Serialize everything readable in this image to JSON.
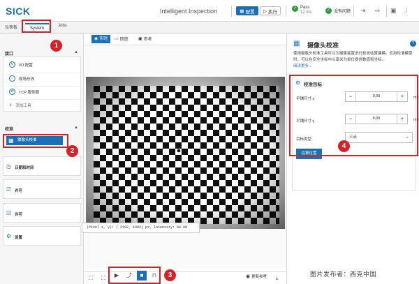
{
  "app": {
    "logo": "SICK",
    "title": "Intelligent Inspection",
    "config_label": "配置",
    "run_label": "执行",
    "pass_status": "Pass",
    "pass_time": "12 ms",
    "ok_status": "没有问题"
  },
  "tabs": [
    {
      "label": "仪表板"
    },
    {
      "label": "System"
    },
    {
      "label": "Jobs"
    }
  ],
  "sidebar": {
    "interface_title": "接口",
    "interface_items": [
      {
        "label": "I/O 配置",
        "icon": "io-icon"
      },
      {
        "label": "现场总线",
        "icon": "fieldbus-icon"
      },
      {
        "label": "TCP 服务器",
        "icon": "tcp-server-icon"
      }
    ],
    "add_tool": "添加工具",
    "calib_title": "校准",
    "calib_item": "摄像头校准",
    "nav_items": [
      {
        "label": "日期和时间"
      },
      {
        "label": "许可"
      },
      {
        "label": "许可"
      },
      {
        "label": "设置"
      }
    ]
  },
  "viewer": {
    "tab_live": "实时",
    "tab_playback": "回放",
    "tab_reference": "参考",
    "pixel_readout": "(Pixel x, y): ( 2192,  1982) px, Intensity:     94.00",
    "more_ref": "更新参考"
  },
  "panel": {
    "title": "摄像头校准",
    "description": "使用摄像头校准工具可以为摄像装置进行校准估算建模。应用校准模型时，可以在安全坐标中以毫米为单位提供数值和坐标。",
    "read_more": "阅读更多...",
    "calib_target_title": "校准目标",
    "tile_x_label": "平铺尺寸 x",
    "tile_x_value": "9.00",
    "tile_y_label": "平铺尺寸 y",
    "tile_y_value": "9.00",
    "unit": "mm",
    "target_type_label": "目标类型",
    "target_type_value": "三点",
    "calc_button": "估算位置"
  },
  "badges": [
    "1",
    "2",
    "3",
    "4"
  ],
  "watermark": "图片发布者：西克中国",
  "colors": {
    "accent": "#1a6fb5",
    "highlight": "#d92027",
    "pass": "#2e9c3e"
  }
}
